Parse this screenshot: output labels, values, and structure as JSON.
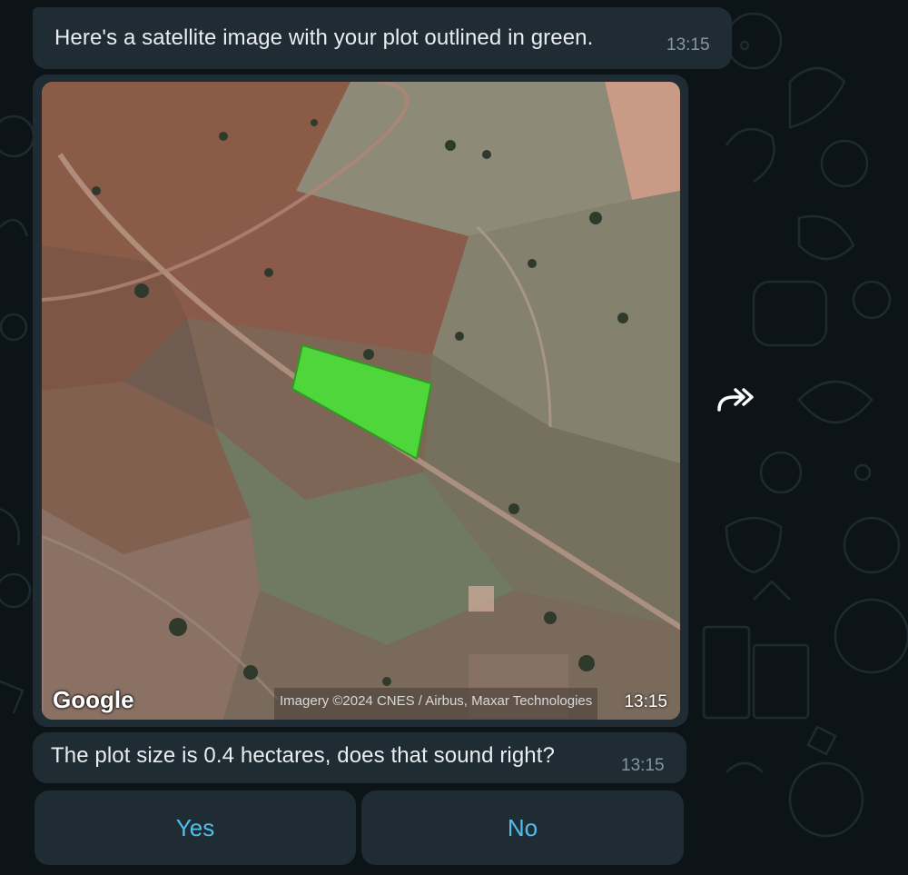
{
  "messages": {
    "intro": {
      "text": "Here's a satellite image with your plot outlined in green.",
      "time": "13:15"
    },
    "image": {
      "logo": "Google",
      "attribution": "Imagery ©2024 CNES / Airbus, Maxar Technologies",
      "time": "13:15"
    },
    "question": {
      "text": "The plot size is 0.4 hectares, does that sound right?",
      "time": "13:15"
    }
  },
  "quick_replies": [
    "Yes",
    "No"
  ],
  "icons": {
    "forward": "forward-icon"
  },
  "colors": {
    "background": "#0d1418",
    "bubble": "#1f2c34",
    "link_blue": "#53bdeb",
    "plot_green": "#4fd63a"
  }
}
